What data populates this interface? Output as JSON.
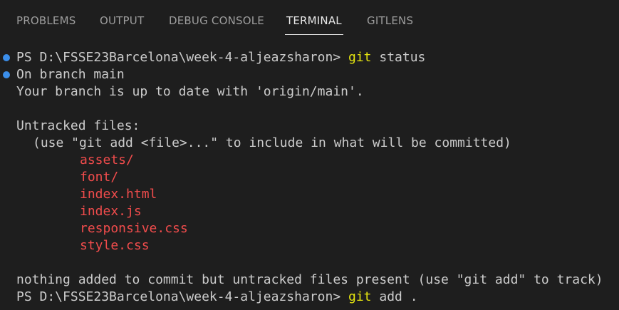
{
  "tabs": [
    {
      "label": "PROBLEMS"
    },
    {
      "label": "OUTPUT"
    },
    {
      "label": "DEBUG CONSOLE"
    },
    {
      "label": "TERMINAL"
    },
    {
      "label": "GITLENS"
    }
  ],
  "active_tab": "TERMINAL",
  "terminal": {
    "prompt": "PS D:\\FSSE23Barcelona\\week-4-aljeazsharon>",
    "cmd1_git": "git",
    "cmd1_args": " status",
    "branch_line": "On branch main",
    "uptodate_line": "Your branch is up to date with 'origin/main'.",
    "untracked_header": "Untracked files:",
    "hint_line": "(use \"git add <file>...\" to include in what will be committed)",
    "files": [
      "assets/",
      "font/",
      "index.html",
      "index.js",
      "responsive.css",
      "style.css"
    ],
    "nothing_line": "nothing added to commit but untracked files present (use \"git add\" to track)",
    "cmd2_git": "git",
    "cmd2_args": " add ."
  },
  "colors": {
    "background": "#1e1e1e",
    "text": "#cccccc",
    "git_command": "#e5e510",
    "untracked_file": "#f14c4c",
    "decoration_dot": "#3b8eea"
  }
}
